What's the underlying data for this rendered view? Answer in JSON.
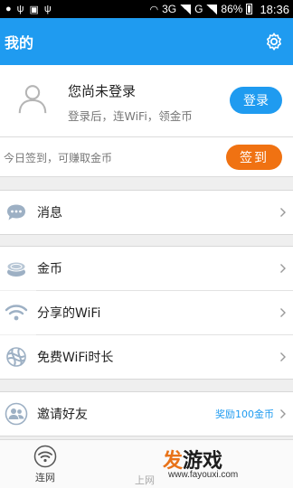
{
  "status_bar": {
    "network_1": "3G",
    "network_2": "G",
    "battery": "86%",
    "time": "18:36"
  },
  "header": {
    "title": "我的",
    "settings_icon": "gear-icon"
  },
  "profile": {
    "title": "您尚未登录",
    "subtitle": "登录后，连WiFi，领金币",
    "login_button": "登录",
    "avatar_icon": "user-avatar-icon"
  },
  "checkin": {
    "text": "今日签到，可赚取金币",
    "button": "签到"
  },
  "menu": {
    "messages": {
      "label": "消息",
      "icon": "chat-bubble-icon"
    },
    "coins": {
      "label": "金币",
      "icon": "coins-icon"
    },
    "shared_wifi": {
      "label": "分享的WiFi",
      "icon": "wifi-icon"
    },
    "free_wifi_time": {
      "label": "免费WiFi时长",
      "icon": "carrier-logo-icon"
    },
    "invite": {
      "label": "邀请好友",
      "hint": "奖励100金币",
      "icon": "friends-icon"
    }
  },
  "bottom_nav": {
    "connect": "连网",
    "online": "上网"
  },
  "watermark": {
    "brand": "发游戏",
    "url": "www.fayouxi.com"
  },
  "colors": {
    "primary": "#1f9bf0",
    "checkin_button": "#f07212"
  }
}
